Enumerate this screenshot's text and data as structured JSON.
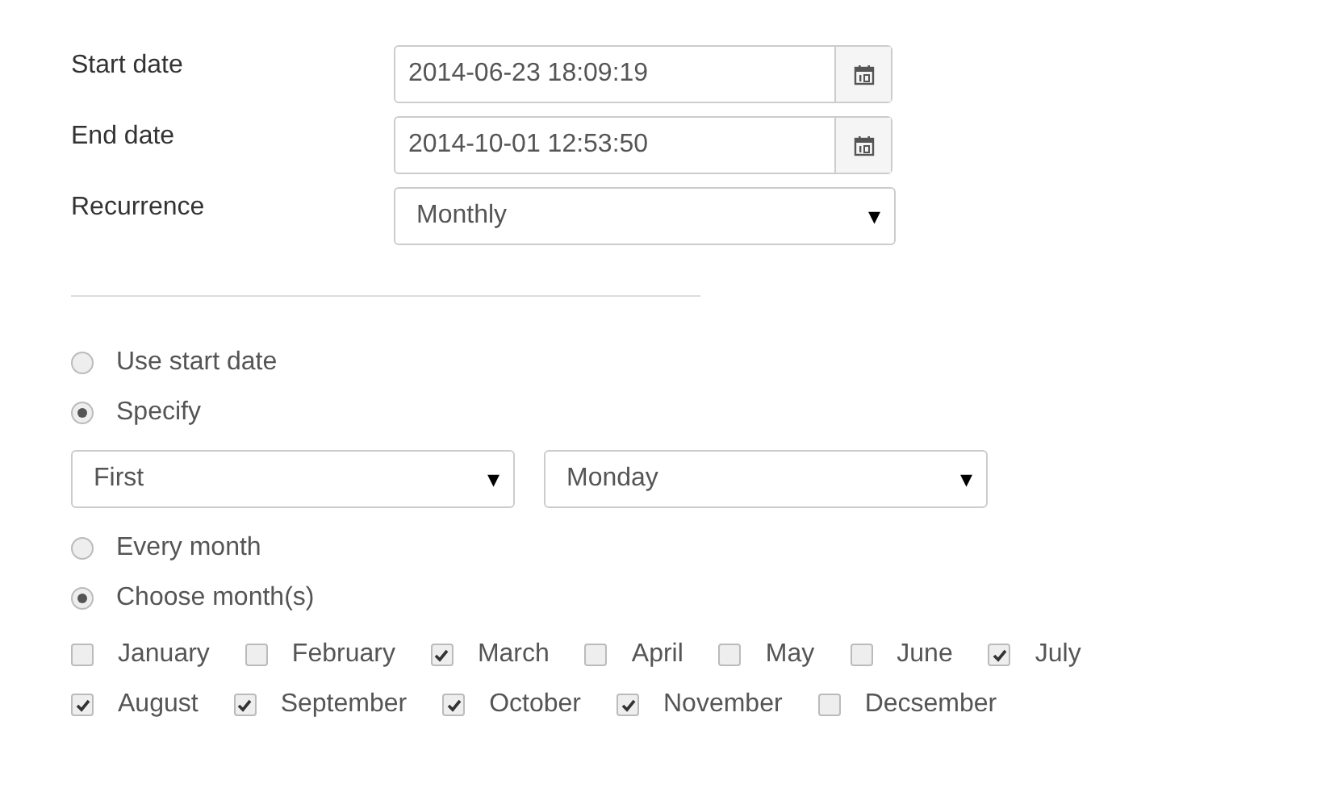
{
  "fields": [
    {
      "label": "Start date",
      "kind": "date",
      "value": "2014-06-23 18:09:19"
    },
    {
      "label": "End date",
      "kind": "date",
      "value": "2014-10-01 12:53:50"
    },
    {
      "label": "Recurrence",
      "kind": "select",
      "value": "Monthly"
    }
  ],
  "day_mode": [
    {
      "label": "Use start date",
      "selected": false
    },
    {
      "label": "Specify",
      "selected": true
    }
  ],
  "day_selects": [
    {
      "value": "First",
      "caret": "▾"
    },
    {
      "value": "Monday",
      "caret": "▾"
    }
  ],
  "month_mode": [
    {
      "label": "Every month",
      "selected": false
    },
    {
      "label": "Choose month(s)",
      "selected": true
    }
  ],
  "month_rows": [
    [
      {
        "label": "January",
        "checked": false
      },
      {
        "label": "February",
        "checked": false
      },
      {
        "label": "March",
        "checked": true
      },
      {
        "label": "April",
        "checked": false
      },
      {
        "label": "May",
        "checked": false
      },
      {
        "label": "June",
        "checked": false
      },
      {
        "label": "July",
        "checked": true
      }
    ],
    [
      {
        "label": "August",
        "checked": true
      },
      {
        "label": "September",
        "checked": true
      },
      {
        "label": "October",
        "checked": true
      },
      {
        "label": "November",
        "checked": true
      },
      {
        "label": "Decsember",
        "checked": false
      }
    ]
  ],
  "select_caret": "▾"
}
